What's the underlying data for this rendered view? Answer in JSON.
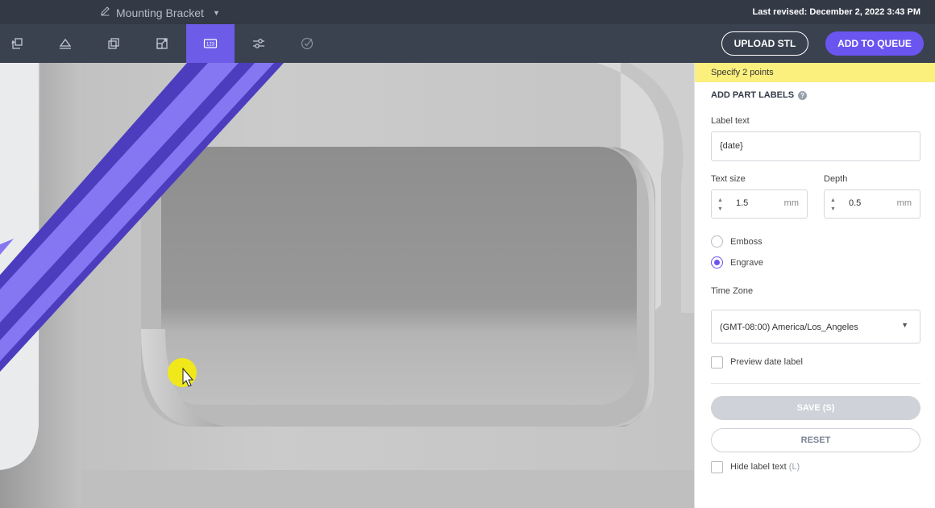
{
  "header": {
    "title": "Mounting Bracket",
    "last_revised": "Last revised: December 2, 2022 3:43 PM"
  },
  "toolbar": {
    "tools": [
      {
        "icon": "orient-icon"
      },
      {
        "icon": "flat-face-icon"
      },
      {
        "icon": "copies-icon"
      },
      {
        "icon": "scale-icon"
      },
      {
        "icon": "part-labels-icon",
        "label": "123",
        "active": true
      },
      {
        "icon": "settings-sliders-icon"
      },
      {
        "icon": "check-icon"
      }
    ],
    "upload_label": "UPLOAD STL",
    "queue_label": "ADD TO QUEUE"
  },
  "colors": {
    "accent": "#6b55f0",
    "header_bg": "#333a46",
    "toolbar_bg": "#3a4250",
    "hint_bg": "#fbf07d",
    "label_stripe_light": "#8577f1",
    "label_stripe_dark": "#4c3dbf"
  },
  "panel": {
    "hint": "Specify 2 points",
    "section_title": "ADD PART LABELS",
    "label_text_label": "Label text",
    "label_text_value": "{date}",
    "text_size_label": "Text size",
    "text_size_value": "1.5",
    "text_size_unit": "mm",
    "depth_label": "Depth",
    "depth_value": "0.5",
    "depth_unit": "mm",
    "emboss_label": "Emboss",
    "engrave_label": "Engrave",
    "mode_selected": "Engrave",
    "timezone_label": "Time Zone",
    "timezone_value": "(GMT-08:00) America/Los_Angeles",
    "preview_label": "Preview date label",
    "preview_checked": false,
    "save_label": "SAVE (S)",
    "reset_label": "RESET",
    "hide_label": "Hide label text",
    "hide_shortcut": "(L)",
    "hide_checked": false
  }
}
